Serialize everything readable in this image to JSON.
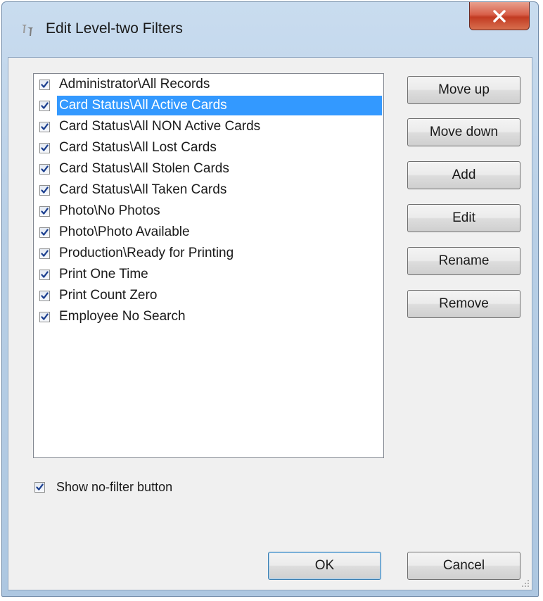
{
  "window": {
    "title": "Edit Level-two Filters",
    "close_icon": "close-icon",
    "app_icon": "app-filter-icon"
  },
  "filters": {
    "selected_index": 1,
    "items": [
      {
        "label": "Administrator\\All Records",
        "checked": true
      },
      {
        "label": "Card Status\\All Active Cards",
        "checked": true
      },
      {
        "label": "Card Status\\All NON Active Cards",
        "checked": true
      },
      {
        "label": "Card Status\\All Lost Cards",
        "checked": true
      },
      {
        "label": "Card Status\\All Stolen Cards",
        "checked": true
      },
      {
        "label": "Card Status\\All Taken Cards",
        "checked": true
      },
      {
        "label": "Photo\\No Photos",
        "checked": true
      },
      {
        "label": "Photo\\Photo Available",
        "checked": true
      },
      {
        "label": "Production\\Ready for Printing",
        "checked": true
      },
      {
        "label": "Print One Time",
        "checked": true
      },
      {
        "label": "Print Count Zero",
        "checked": true
      },
      {
        "label": "Employee No Search",
        "checked": true
      }
    ]
  },
  "buttons": {
    "move_up": "Move up",
    "move_down": "Move down",
    "add": "Add",
    "edit": "Edit",
    "rename": "Rename",
    "remove": "Remove",
    "ok": "OK",
    "cancel": "Cancel"
  },
  "options": {
    "show_no_filter_label": "Show no-filter button",
    "show_no_filter_checked": true
  },
  "colors": {
    "selection": "#3399ff",
    "close_button": "#c23b22",
    "window_frame": "#b8cfe6",
    "checkmark": "#1b3f8f"
  }
}
